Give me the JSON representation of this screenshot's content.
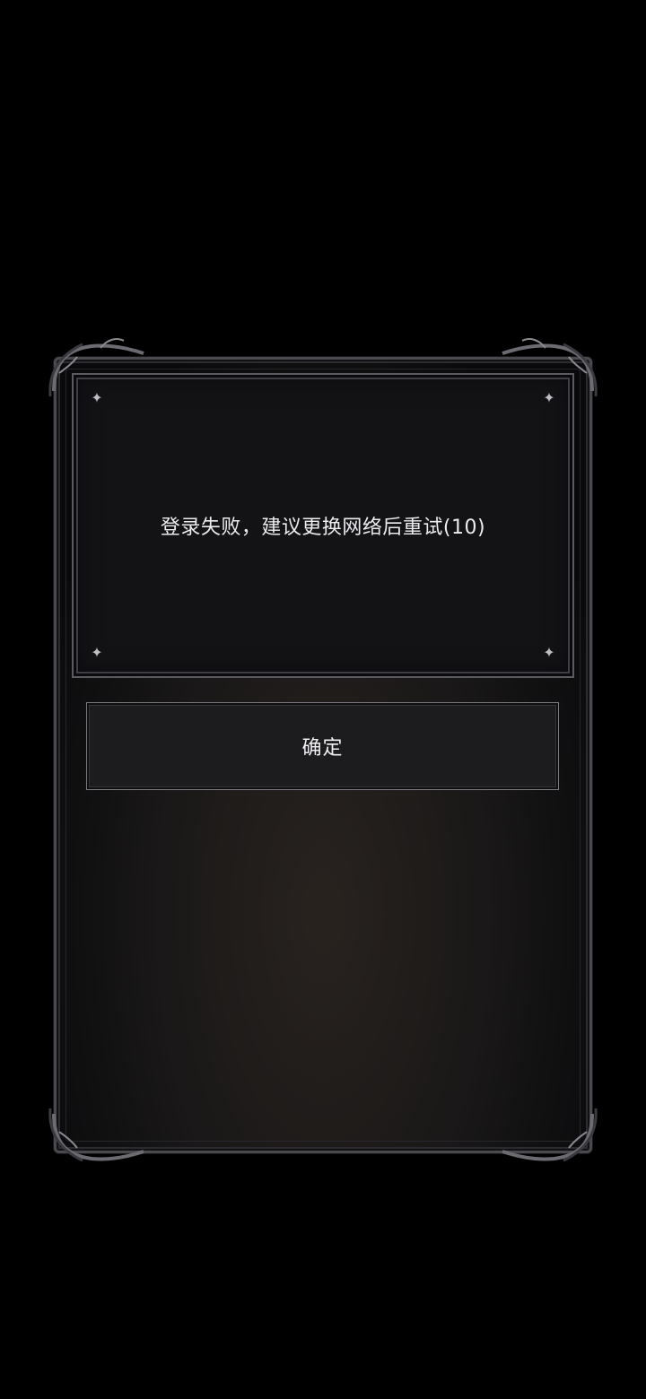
{
  "dialog": {
    "message": "登录失败，建议更换网络后重试(10)",
    "confirm_label": "确定"
  },
  "icons": {
    "corner_sparkle": "sparkle-icon",
    "frame_ornament": "ornament-decoration"
  },
  "colors": {
    "background": "#000000",
    "panel": "#131316",
    "frame_border": "#5a5a60",
    "text": "#ececf0"
  }
}
